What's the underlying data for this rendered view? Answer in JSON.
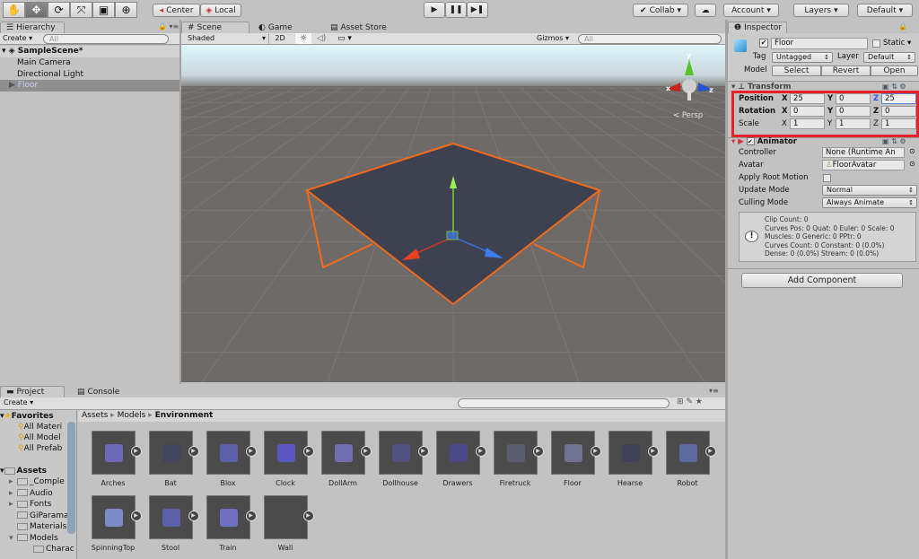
{
  "toolbar": {
    "tools": [
      {
        "icon": "hand-icon",
        "glyph": "✋"
      },
      {
        "icon": "move-icon",
        "glyph": "✥"
      },
      {
        "icon": "rotate-icon",
        "glyph": "⟳"
      },
      {
        "icon": "scale-icon",
        "glyph": "⤧"
      },
      {
        "icon": "rect-icon",
        "glyph": "▣"
      },
      {
        "icon": "transform-icon",
        "glyph": "⊕"
      }
    ],
    "selected_tool": "move",
    "pivot": "Center",
    "space": "Local",
    "play_glyphs": [
      "▶",
      "❚❚",
      "▶❚"
    ],
    "collab": "Collab ▾",
    "account": "Account",
    "layers": "Layers",
    "layout": "Default"
  },
  "hierarchy": {
    "tab": "Hierarchy",
    "create": "Create",
    "search_placeholder": "All",
    "scene": "SampleScene*",
    "items": [
      "Main Camera",
      "Directional Light",
      "Floor"
    ],
    "selected": "Floor"
  },
  "scene": {
    "tabs": [
      "Scene",
      "Game",
      "Asset Store"
    ],
    "shading": "Shaded",
    "mode2d": "2D",
    "gizmos": "Gizmos",
    "search_placeholder": "All",
    "projection": "Persp",
    "axes": {
      "x": "x",
      "y": "y",
      "z": "z"
    },
    "colors": {
      "selection_outline": "#f26a1b",
      "axis_x": "#d9321f",
      "axis_y": "#7fd13b",
      "axis_z": "#3a6fd8"
    }
  },
  "inspector": {
    "tab": "Inspector",
    "name": "Floor",
    "active": true,
    "static_label": "Static",
    "tag_label": "Tag",
    "tag": "Untagged",
    "layer_label": "Layer",
    "layer": "Default",
    "model_label": "Model",
    "model_buttons": [
      "Select",
      "Revert",
      "Open"
    ],
    "transform": {
      "title": "Transform",
      "position": {
        "label": "Position",
        "x": "25",
        "y": "0",
        "z": "25"
      },
      "rotation": {
        "label": "Rotation",
        "x": "0",
        "y": "0",
        "z": "0"
      },
      "scale": {
        "label": "Scale",
        "x": "1",
        "y": "1",
        "z": "1"
      },
      "axis_labels": [
        "X",
        "Y",
        "Z"
      ]
    },
    "highlight_color": "#e8202a",
    "animator": {
      "title": "Animator",
      "enabled": true,
      "controller_label": "Controller",
      "controller": "None (Runtime An",
      "avatar_label": "Avatar",
      "avatar": "FloorAvatar",
      "root_motion_label": "Apply Root Motion",
      "root_motion": false,
      "update_label": "Update Mode",
      "update": "Normal",
      "culling_label": "Culling Mode",
      "culling": "Always Animate",
      "info": [
        "Clip Count: 0",
        "Curves Pos: 0 Quat: 0 Euler: 0 Scale: 0",
        "Muscles: 0 Generic: 0 PPtr: 0",
        "Curves Count: 0 Constant: 0 (0.0%)",
        "Dense: 0 (0.0%) Stream: 0 (0.0%)"
      ]
    },
    "add_component": "Add Component"
  },
  "project": {
    "tabs": [
      "Project",
      "Console"
    ],
    "create": "Create",
    "favorites": "Favorites",
    "favorite_items": [
      "All Materi",
      "All Model",
      "All Prefab"
    ],
    "assets": "Assets",
    "folders": [
      {
        "name": "_Comple",
        "expandable": true
      },
      {
        "name": "Audio",
        "expandable": true
      },
      {
        "name": "Fonts",
        "expandable": true
      },
      {
        "name": "GiParama",
        "expandable": false
      },
      {
        "name": "Materials",
        "expandable": false
      },
      {
        "name": "Models",
        "expandable": true,
        "open": true
      },
      {
        "name": "Charac",
        "expandable": false,
        "child": true
      }
    ],
    "breadcrumb": [
      "Assets",
      "Models",
      "Environment"
    ],
    "items": [
      "Arches",
      "Bat",
      "Blox",
      "Clock",
      "DollArm",
      "Dollhouse",
      "Drawers",
      "Firetruck",
      "Floor",
      "Hearse",
      "Robot",
      "SpinningTop",
      "Stool",
      "Train",
      "Wall"
    ]
  }
}
